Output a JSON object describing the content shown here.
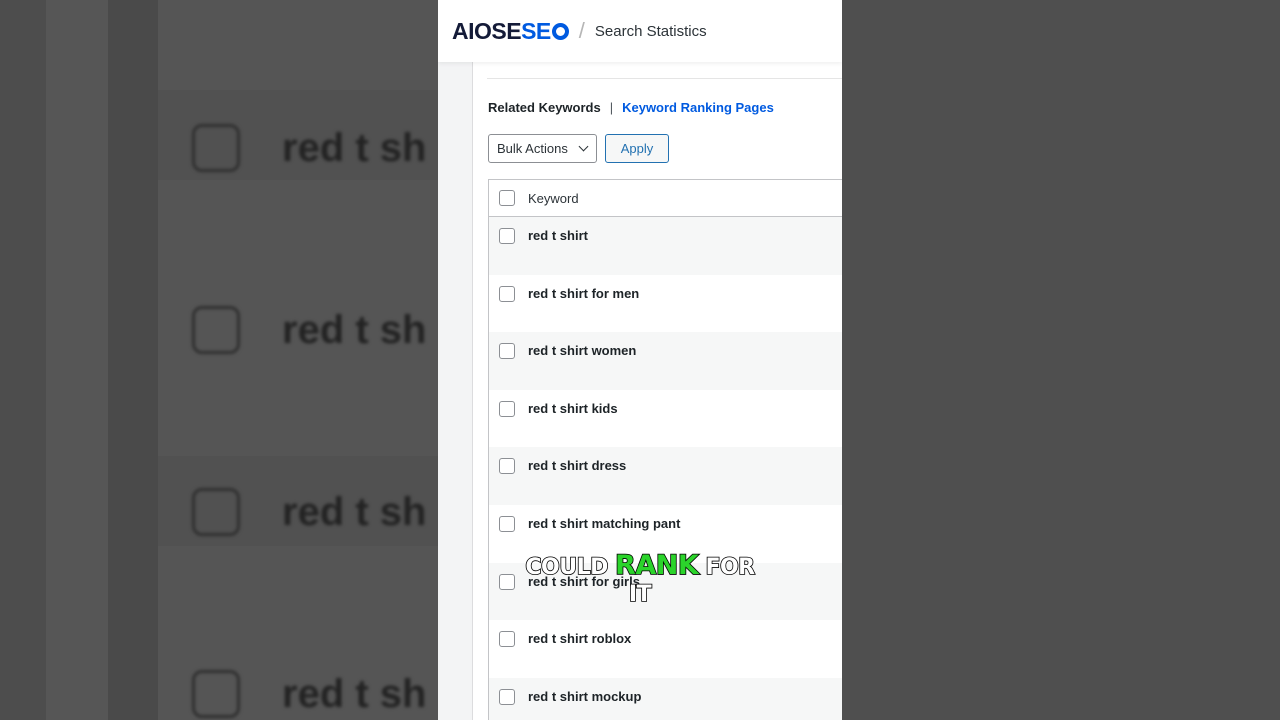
{
  "header": {
    "logo_left": "AIOSE",
    "logo_right": "",
    "separator": "/",
    "breadcrumb": "Search Statistics"
  },
  "tabs": {
    "active": "Related Keywords",
    "divider": "|",
    "link": "Keyword Ranking Pages"
  },
  "toolbar": {
    "bulk_actions": "Bulk Actions",
    "apply": "Apply"
  },
  "table": {
    "header": "Keyword",
    "rows": [
      "red t shirt",
      "red t shirt for men",
      "red t shirt women",
      "red t shirt kids",
      "red t shirt dress",
      "red t shirt matching pant",
      "red t shirt for girls",
      "red t shirt roblox",
      "red t shirt mockup"
    ]
  },
  "background": {
    "blurred_text": "red t sh"
  },
  "caption": {
    "word1": "COULD",
    "word2": "RANK",
    "word3": "FOR",
    "word4": "IT"
  },
  "colors": {
    "brand_blue": "#005ae0",
    "caption_highlight": "#2bd42b"
  }
}
